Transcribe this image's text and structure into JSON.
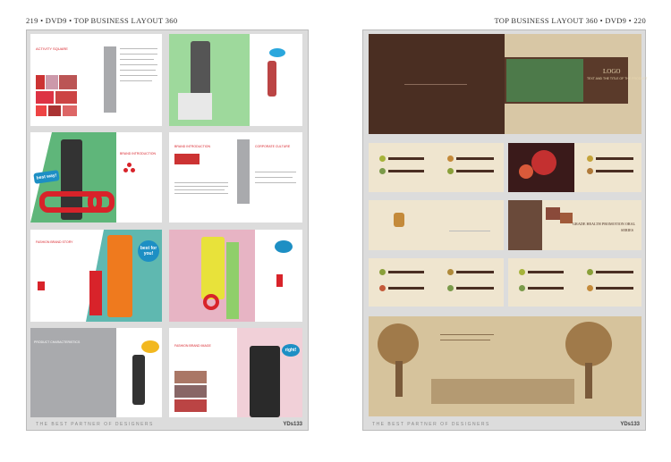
{
  "header_left": "219 • DVD9 • TOP BUSINESS LAYOUT 360",
  "header_right": "TOP BUSINESS LAYOUT 360 • DVD9 • 220",
  "footer_text": "THE BEST PARTNER OF DESIGNERS",
  "footer_code": "YDs133",
  "left_page": {
    "spread1": {
      "title": "ACTIVITY SQUARE"
    },
    "spread2": {
      "bubble": "best way!",
      "title": "BRAND INTRODUCTION",
      "right_title": "CORPORATE CULTURE"
    },
    "spread3": {
      "title": "FASHION BRAND STORY",
      "bubble": "best for you!"
    },
    "spread4": {
      "title": "PRODUCT CHARACTERISTICS",
      "right_title": "FASHION BRAND IMAGE",
      "bubble": "right!"
    }
  },
  "right_page": {
    "cover": {
      "logo": "LOGO",
      "tagline": "TEXT AND THE TITLE OF THE PRODUCT"
    },
    "spread_c": {
      "title": "GRADE HEALTH PROMOTION ORAL",
      "subtitle": "SERIES"
    }
  },
  "colors": {
    "accent_red": "#d8232a",
    "brown": "#4a2e22",
    "cream": "#efe5cf",
    "gray_bar": "#a9aaad"
  }
}
